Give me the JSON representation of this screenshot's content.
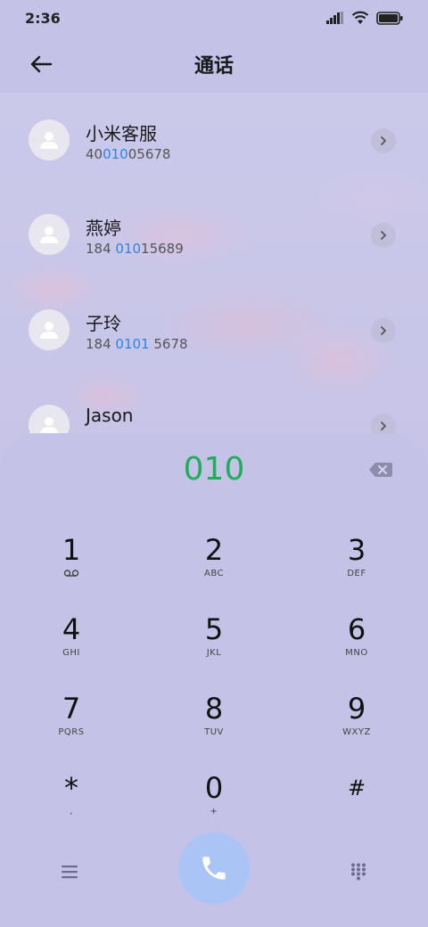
{
  "status_bar": {
    "time": "2:36"
  },
  "app_bar": {
    "title": "通话"
  },
  "contacts": [
    {
      "name": "小米客服",
      "number_pre": "40",
      "number_hl": "010",
      "number_post": "05678"
    },
    {
      "name": "燕婷",
      "number_pre": "184 ",
      "number_hl": "010",
      "number_post": "15689"
    },
    {
      "name": "子玲",
      "number_pre": "184 ",
      "number_hl": "0101",
      "number_post": " 5678"
    },
    {
      "name": "Jason",
      "number_pre": "",
      "number_hl": "",
      "number_post": ""
    }
  ],
  "dialpad": {
    "input": "010",
    "keys": [
      {
        "digit": "1",
        "sub": "voicemail-icon"
      },
      {
        "digit": "2",
        "sub": "ABC"
      },
      {
        "digit": "3",
        "sub": "DEF"
      },
      {
        "digit": "4",
        "sub": "GHI"
      },
      {
        "digit": "5",
        "sub": "JKL"
      },
      {
        "digit": "6",
        "sub": "MNO"
      },
      {
        "digit": "7",
        "sub": "PQRS"
      },
      {
        "digit": "8",
        "sub": "TUV"
      },
      {
        "digit": "9",
        "sub": "WXYZ"
      },
      {
        "digit": "*",
        "sub": ","
      },
      {
        "digit": "0",
        "sub": "+"
      },
      {
        "digit": "#",
        "sub": ""
      }
    ]
  },
  "colors": {
    "background": "#c4c2e6",
    "highlight": "#2a86e6",
    "dial_text": "#1fae5a",
    "call_button": "#a9c4f5"
  }
}
